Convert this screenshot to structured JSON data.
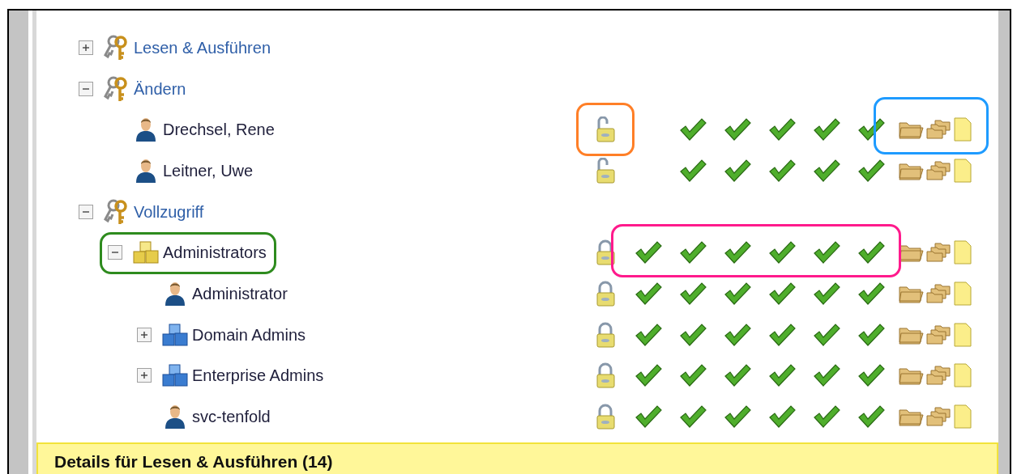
{
  "tree": [
    {
      "kind": "permission",
      "label": "Lesen & Ausführen",
      "expanded": false
    },
    {
      "kind": "permission",
      "label": "Ändern",
      "expanded": true,
      "children": [
        {
          "kind": "user",
          "label": "Drechsel, Rene",
          "locked": false,
          "rights": [
            false,
            true,
            true,
            true,
            true,
            true
          ],
          "applies_to": {
            "folder": true,
            "subfolders": true,
            "files": true
          },
          "highlights": [
            {
              "kind": "lock",
              "color": "#ff7f27"
            },
            {
              "kind": "scope",
              "color": "#1e9bff"
            }
          ]
        },
        {
          "kind": "user",
          "label": "Leitner, Uwe",
          "locked": false,
          "rights": [
            false,
            true,
            true,
            true,
            true,
            true
          ],
          "applies_to": {
            "folder": true,
            "subfolders": true,
            "files": true
          }
        }
      ]
    },
    {
      "kind": "permission",
      "label": "Vollzugriff",
      "expanded": true,
      "children": [
        {
          "kind": "group",
          "label": "Administrators",
          "expanded": true,
          "locked": true,
          "rights": [
            true,
            true,
            true,
            true,
            true,
            true
          ],
          "applies_to": {
            "folder": true,
            "subfolders": true,
            "files": true
          },
          "highlights": [
            {
              "kind": "label",
              "color": "#2e8b1e"
            },
            {
              "kind": "rights",
              "color": "#ff1a8c"
            }
          ],
          "children": [
            {
              "kind": "user",
              "label": "Administrator",
              "locked": true,
              "rights": [
                true,
                true,
                true,
                true,
                true,
                true
              ],
              "applies_to": {
                "folder": true,
                "subfolders": true,
                "files": true
              }
            },
            {
              "kind": "domain_group",
              "label": "Domain Admins",
              "expanded": false,
              "locked": true,
              "rights": [
                true,
                true,
                true,
                true,
                true,
                true
              ],
              "applies_to": {
                "folder": true,
                "subfolders": true,
                "files": true
              }
            },
            {
              "kind": "domain_group",
              "label": "Enterprise Admins",
              "expanded": false,
              "locked": true,
              "rights": [
                true,
                true,
                true,
                true,
                true,
                true
              ],
              "applies_to": {
                "folder": true,
                "subfolders": true,
                "files": true
              }
            },
            {
              "kind": "user",
              "label": "svc-tenfold",
              "locked": true,
              "rights": [
                true,
                true,
                true,
                true,
                true,
                true
              ],
              "applies_to": {
                "folder": true,
                "subfolders": true,
                "files": true
              }
            }
          ]
        }
      ]
    }
  ],
  "details": {
    "title": "Details für Lesen & Ausführen (14)"
  }
}
